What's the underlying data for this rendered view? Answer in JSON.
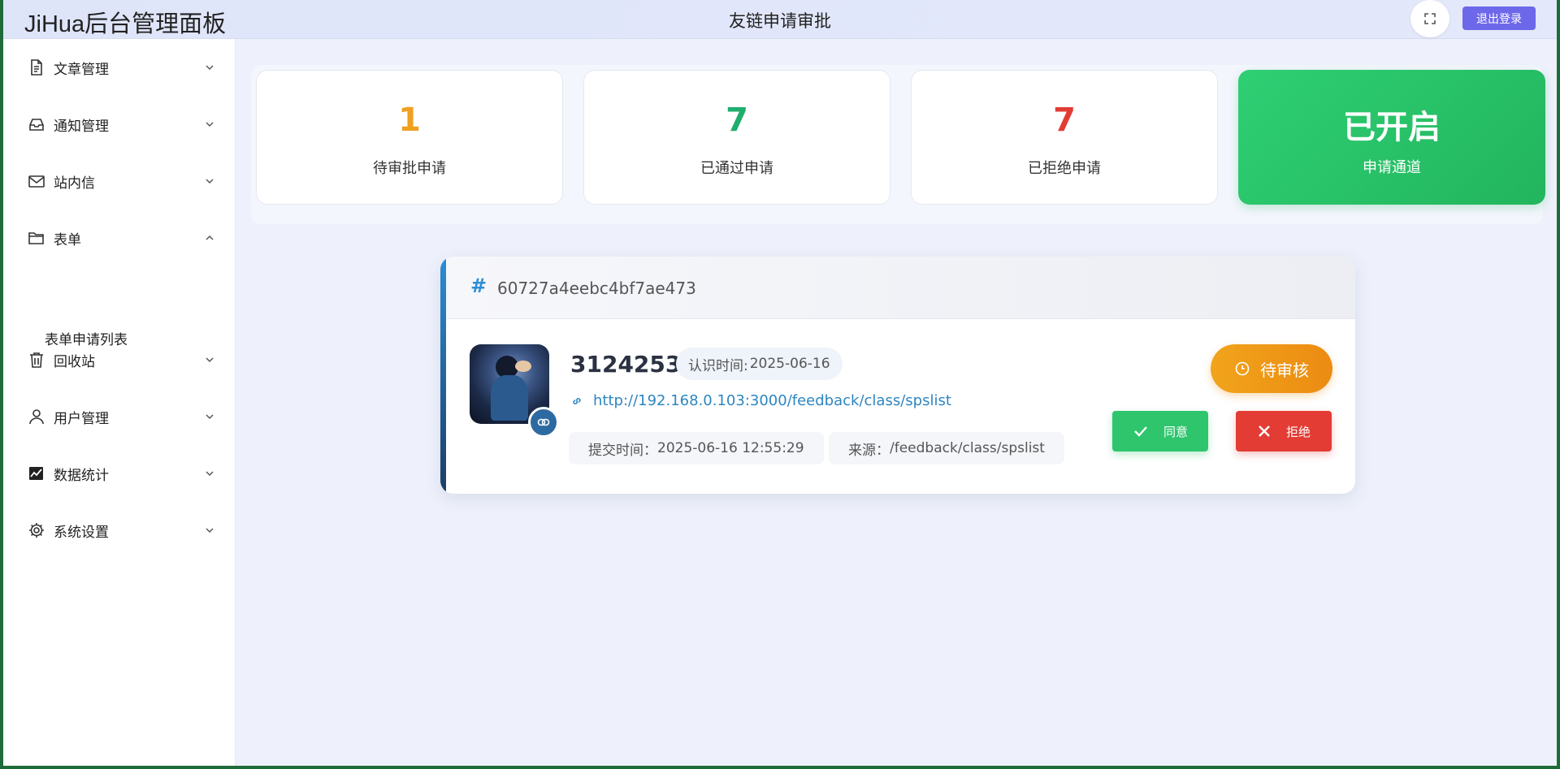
{
  "header": {
    "brand": "JiHua后台管理面板",
    "page_title": "友链申请审批",
    "logout_label": "退出登录"
  },
  "sidebar": {
    "items": [
      {
        "label": "文章管理",
        "icon": "document-icon",
        "expanded": false
      },
      {
        "label": "通知管理",
        "icon": "inbox-icon",
        "expanded": false
      },
      {
        "label": "站内信",
        "icon": "mail-icon",
        "expanded": false
      },
      {
        "label": "表单",
        "icon": "folder-icon",
        "expanded": true
      },
      {
        "label": "回收站",
        "icon": "trash-icon",
        "expanded": false
      },
      {
        "label": "用户管理",
        "icon": "user-icon",
        "expanded": false
      },
      {
        "label": "数据统计",
        "icon": "chart-icon",
        "expanded": false
      },
      {
        "label": "系统设置",
        "icon": "gear-icon",
        "expanded": false
      }
    ],
    "subitems": [
      {
        "label": "表单申请列表"
      }
    ]
  },
  "stats": [
    {
      "value": "1",
      "label": "待审批申请",
      "color": "#f0a020"
    },
    {
      "value": "7",
      "label": "已通过申请",
      "color": "#1fae6e"
    },
    {
      "value": "7",
      "label": "已拒绝申请",
      "color": "#e23c35"
    },
    {
      "value": "已开启",
      "label": "申请通道",
      "color": "#2fcf74"
    }
  ],
  "request": {
    "id": "60727a4eebc4bf7ae473",
    "name": "3124253",
    "known_label": "认识时间:",
    "known_date": "2025-06-16",
    "url": "http://192.168.0.103:3000/feedback/class/spslist",
    "submit_label": "提交时间：",
    "submit_time": "2025-06-16 12:55:29",
    "source_label": "来源：",
    "source": "/feedback/class/spslist",
    "status": "待审核",
    "approve_label": "同意",
    "reject_label": "拒绝"
  }
}
